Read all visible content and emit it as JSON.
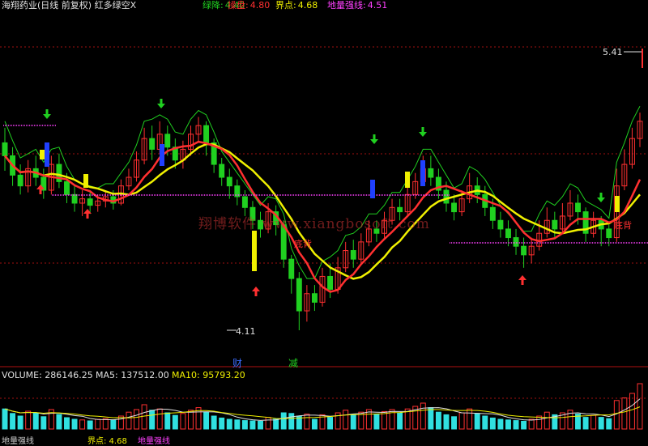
{
  "header": {
    "title": "海翔药业(日线 前复权) 红多绿空X",
    "items": [
      {
        "label": "绿降:",
        "value": "4.40",
        "color": "#20d020"
      },
      {
        "label": "操盘:",
        "value": "4.80",
        "color": "#ff3030"
      },
      {
        "label": "界点:",
        "value": "4.68",
        "color": "#f0f000"
      },
      {
        "label": "地量强线:",
        "value": "4.51",
        "color": "#ff40ff"
      }
    ]
  },
  "price_labels": {
    "high": "5.41",
    "low": "4.11"
  },
  "annotations": {
    "cai": "财",
    "jian": "减",
    "di_bei_1": "底背",
    "di_bei_2": "底背"
  },
  "watermark": "翔博软件 www.xiangbosoft.com",
  "volume_header": {
    "volume": "VOLUME: 286146.25",
    "ma5": "MA5: 137512.00",
    "ma10": "MA10: 95793.20"
  },
  "bottom_partial": {
    "left": "地量强线",
    "mid": "界点: 4.68",
    "right": "地量强线"
  },
  "colors": {
    "up": "#ff3030",
    "down": "#20d020",
    "yellow": "#f0f000",
    "magenta": "#ff40ff",
    "cyan": "#30e0e0",
    "blue": "#2040ff",
    "grid": "#a01010"
  },
  "chart_data": {
    "type": "candlestick",
    "y_high_marker": 5.41,
    "y_low_marker": 4.11,
    "candles": [
      [
        4.98,
        4.92,
        5.05,
        4.85
      ],
      [
        4.92,
        4.83,
        4.96,
        4.78
      ],
      [
        4.83,
        4.78,
        4.88,
        4.74
      ],
      [
        4.78,
        4.86,
        4.9,
        4.75
      ],
      [
        4.86,
        4.82,
        4.92,
        4.78
      ],
      [
        4.82,
        4.76,
        4.86,
        4.72
      ],
      [
        4.76,
        4.88,
        4.92,
        4.74
      ],
      [
        4.88,
        4.8,
        4.93,
        4.77
      ],
      [
        4.8,
        4.74,
        4.84,
        4.7
      ],
      [
        4.74,
        4.7,
        4.78,
        4.66
      ],
      [
        4.7,
        4.72,
        4.76,
        4.64
      ],
      [
        4.72,
        4.69,
        4.75,
        4.65
      ],
      [
        4.69,
        4.71,
        4.74,
        4.66
      ],
      [
        4.71,
        4.73,
        4.76,
        4.68
      ],
      [
        4.73,
        4.7,
        4.76,
        4.67
      ],
      [
        4.7,
        4.78,
        4.81,
        4.69
      ],
      [
        4.78,
        4.82,
        4.86,
        4.76
      ],
      [
        4.82,
        4.9,
        4.94,
        4.8
      ],
      [
        4.9,
        5.0,
        5.05,
        4.88
      ],
      [
        5.0,
        4.95,
        5.06,
        4.9
      ],
      [
        4.95,
        5.02,
        5.08,
        4.93
      ],
      [
        5.02,
        4.96,
        5.06,
        4.92
      ],
      [
        4.96,
        4.9,
        5.0,
        4.86
      ],
      [
        4.9,
        4.95,
        4.99,
        4.86
      ],
      [
        4.95,
        5.02,
        5.06,
        4.92
      ],
      [
        5.02,
        5.06,
        5.1,
        4.98
      ],
      [
        5.06,
        4.98,
        5.08,
        4.92
      ],
      [
        4.98,
        4.88,
        5.0,
        4.84
      ],
      [
        4.88,
        4.82,
        4.91,
        4.78
      ],
      [
        4.82,
        4.78,
        4.86,
        4.72
      ],
      [
        4.78,
        4.73,
        4.81,
        4.69
      ],
      [
        4.73,
        4.68,
        4.76,
        4.64
      ],
      [
        4.68,
        4.62,
        4.71,
        4.58
      ],
      [
        4.62,
        4.58,
        4.66,
        4.54
      ],
      [
        4.58,
        4.66,
        4.7,
        4.56
      ],
      [
        4.66,
        4.6,
        4.69,
        4.55
      ],
      [
        4.6,
        4.44,
        4.62,
        4.4
      ],
      [
        4.44,
        4.35,
        4.46,
        4.28
      ],
      [
        4.35,
        4.2,
        4.38,
        4.11
      ],
      [
        4.2,
        4.28,
        4.32,
        4.15
      ],
      [
        4.28,
        4.24,
        4.32,
        4.2
      ],
      [
        4.24,
        4.36,
        4.4,
        4.22
      ],
      [
        4.36,
        4.3,
        4.42,
        4.26
      ],
      [
        4.3,
        4.4,
        4.45,
        4.28
      ],
      [
        4.4,
        4.48,
        4.52,
        4.38
      ],
      [
        4.48,
        4.44,
        4.53,
        4.4
      ],
      [
        4.44,
        4.52,
        4.56,
        4.42
      ],
      [
        4.52,
        4.58,
        4.62,
        4.5
      ],
      [
        4.58,
        4.56,
        4.62,
        4.52
      ],
      [
        4.56,
        4.62,
        4.66,
        4.54
      ],
      [
        4.62,
        4.68,
        4.72,
        4.6
      ],
      [
        4.68,
        4.66,
        4.72,
        4.62
      ],
      [
        4.66,
        4.74,
        4.78,
        4.64
      ],
      [
        4.74,
        4.8,
        4.84,
        4.72
      ],
      [
        4.8,
        4.86,
        4.92,
        4.78
      ],
      [
        4.86,
        4.82,
        4.92,
        4.78
      ],
      [
        4.82,
        4.76,
        4.86,
        4.72
      ],
      [
        4.76,
        4.7,
        4.8,
        4.66
      ],
      [
        4.7,
        4.66,
        4.74,
        4.62
      ],
      [
        4.66,
        4.72,
        4.76,
        4.64
      ],
      [
        4.72,
        4.78,
        4.84,
        4.7
      ],
      [
        4.78,
        4.74,
        4.82,
        4.7
      ],
      [
        4.74,
        4.68,
        4.78,
        4.64
      ],
      [
        4.68,
        4.62,
        4.72,
        4.58
      ],
      [
        4.62,
        4.58,
        4.66,
        4.54
      ],
      [
        4.58,
        4.54,
        4.62,
        4.5
      ],
      [
        4.54,
        4.5,
        4.58,
        4.46
      ],
      [
        4.5,
        4.46,
        4.54,
        4.4
      ],
      [
        4.46,
        4.5,
        4.54,
        4.42
      ],
      [
        4.5,
        4.56,
        4.62,
        4.48
      ],
      [
        4.56,
        4.62,
        4.68,
        4.54
      ],
      [
        4.62,
        4.58,
        4.66,
        4.54
      ],
      [
        4.58,
        4.64,
        4.7,
        4.56
      ],
      [
        4.64,
        4.7,
        4.76,
        4.62
      ],
      [
        4.7,
        4.66,
        4.74,
        4.6
      ],
      [
        4.66,
        4.56,
        4.68,
        4.52
      ],
      [
        4.56,
        4.62,
        4.66,
        4.54
      ],
      [
        4.62,
        4.58,
        4.64,
        4.5
      ],
      [
        4.58,
        4.54,
        4.6,
        4.5
      ],
      [
        4.54,
        4.78,
        4.86,
        4.52
      ],
      [
        4.78,
        4.88,
        4.95,
        4.76
      ],
      [
        4.88,
        5.0,
        5.05,
        4.86
      ],
      [
        5.0,
        5.08,
        5.12,
        4.96
      ]
    ],
    "volume": [
      62,
      48,
      40,
      55,
      50,
      38,
      60,
      45,
      35,
      30,
      28,
      25,
      30,
      32,
      28,
      40,
      52,
      60,
      75,
      58,
      62,
      50,
      42,
      48,
      58,
      66,
      52,
      40,
      34,
      30,
      28,
      26,
      25,
      24,
      36,
      30,
      50,
      48,
      40,
      46,
      30,
      44,
      36,
      50,
      58,
      44,
      52,
      60,
      46,
      54,
      60,
      50,
      62,
      70,
      80,
      66,
      52,
      44,
      38,
      50,
      62,
      48,
      40,
      34,
      30,
      28,
      26,
      24,
      30,
      40,
      52,
      44,
      50,
      58,
      46,
      36,
      42,
      36,
      32,
      88,
      96,
      110,
      140
    ],
    "ma5_line": true,
    "ma10_line": true
  }
}
